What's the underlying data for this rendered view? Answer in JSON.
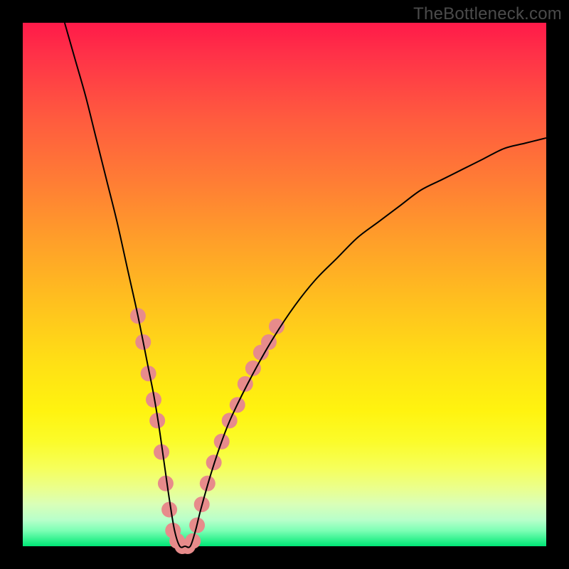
{
  "watermark": "TheBottleneck.com",
  "chart_data": {
    "type": "line",
    "title": "",
    "xlabel": "",
    "ylabel": "",
    "xlim": [
      0,
      100
    ],
    "ylim": [
      0,
      100
    ],
    "grid": false,
    "series": [
      {
        "name": "curve",
        "color": "#000000",
        "width": 2,
        "x": [
          8,
          10,
          12,
          14,
          16,
          18,
          20,
          22,
          24,
          25,
          26,
          27,
          28,
          29,
          30,
          31,
          32,
          33,
          34,
          36,
          38,
          40,
          44,
          48,
          52,
          56,
          60,
          64,
          68,
          72,
          76,
          80,
          84,
          88,
          92,
          96,
          100
        ],
        "y": [
          100,
          93,
          86,
          78,
          70,
          62,
          53,
          44,
          34,
          29,
          23,
          16,
          9,
          3,
          0,
          0,
          0,
          3,
          7,
          14,
          20,
          25,
          33,
          40,
          46,
          51,
          55,
          59,
          62,
          65,
          68,
          70,
          72,
          74,
          76,
          77,
          78
        ]
      }
    ],
    "markers": {
      "name": "highlight-dots",
      "color": "#e78b8b",
      "radius": 11,
      "points": [
        {
          "x": 22.0,
          "y": 44
        },
        {
          "x": 23.0,
          "y": 39
        },
        {
          "x": 24.0,
          "y": 33
        },
        {
          "x": 25.0,
          "y": 28
        },
        {
          "x": 25.7,
          "y": 24
        },
        {
          "x": 26.5,
          "y": 18
        },
        {
          "x": 27.3,
          "y": 12
        },
        {
          "x": 28.0,
          "y": 7
        },
        {
          "x": 28.7,
          "y": 3
        },
        {
          "x": 29.5,
          "y": 1
        },
        {
          "x": 30.5,
          "y": 0
        },
        {
          "x": 31.5,
          "y": 0
        },
        {
          "x": 32.5,
          "y": 1
        },
        {
          "x": 33.3,
          "y": 4
        },
        {
          "x": 34.2,
          "y": 8
        },
        {
          "x": 35.3,
          "y": 12
        },
        {
          "x": 36.5,
          "y": 16
        },
        {
          "x": 38.0,
          "y": 20
        },
        {
          "x": 39.5,
          "y": 24
        },
        {
          "x": 41.0,
          "y": 27
        },
        {
          "x": 42.5,
          "y": 31
        },
        {
          "x": 44.0,
          "y": 34
        },
        {
          "x": 45.5,
          "y": 37
        },
        {
          "x": 47.0,
          "y": 39
        },
        {
          "x": 48.5,
          "y": 42
        }
      ]
    }
  }
}
